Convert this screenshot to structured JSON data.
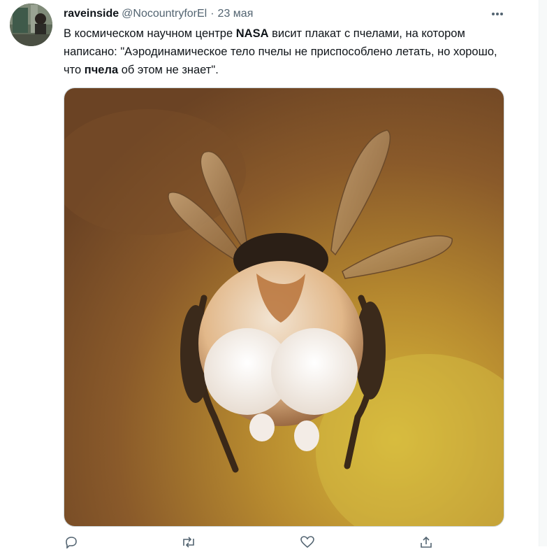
{
  "tweet": {
    "author_name": "raveinside",
    "handle": "@NocountryforEl",
    "separator": "·",
    "time": "23 мая",
    "text_parts": [
      "В космическом научном центре ",
      "NASA",
      " висит плакат с пчелами, на котором написано: \"Аэродинамическое тело пчелы не приспособлено летать, но хорошо, что ",
      "пчела",
      " об этом не знает\"."
    ]
  },
  "icons": {
    "more": "more-dots-icon",
    "reply": "reply-icon",
    "retweet": "retweet-icon",
    "like": "heart-icon",
    "share": "share-icon"
  },
  "colors": {
    "text": "#0f1419",
    "secondary": "#536471",
    "border": "#cfd9de"
  }
}
